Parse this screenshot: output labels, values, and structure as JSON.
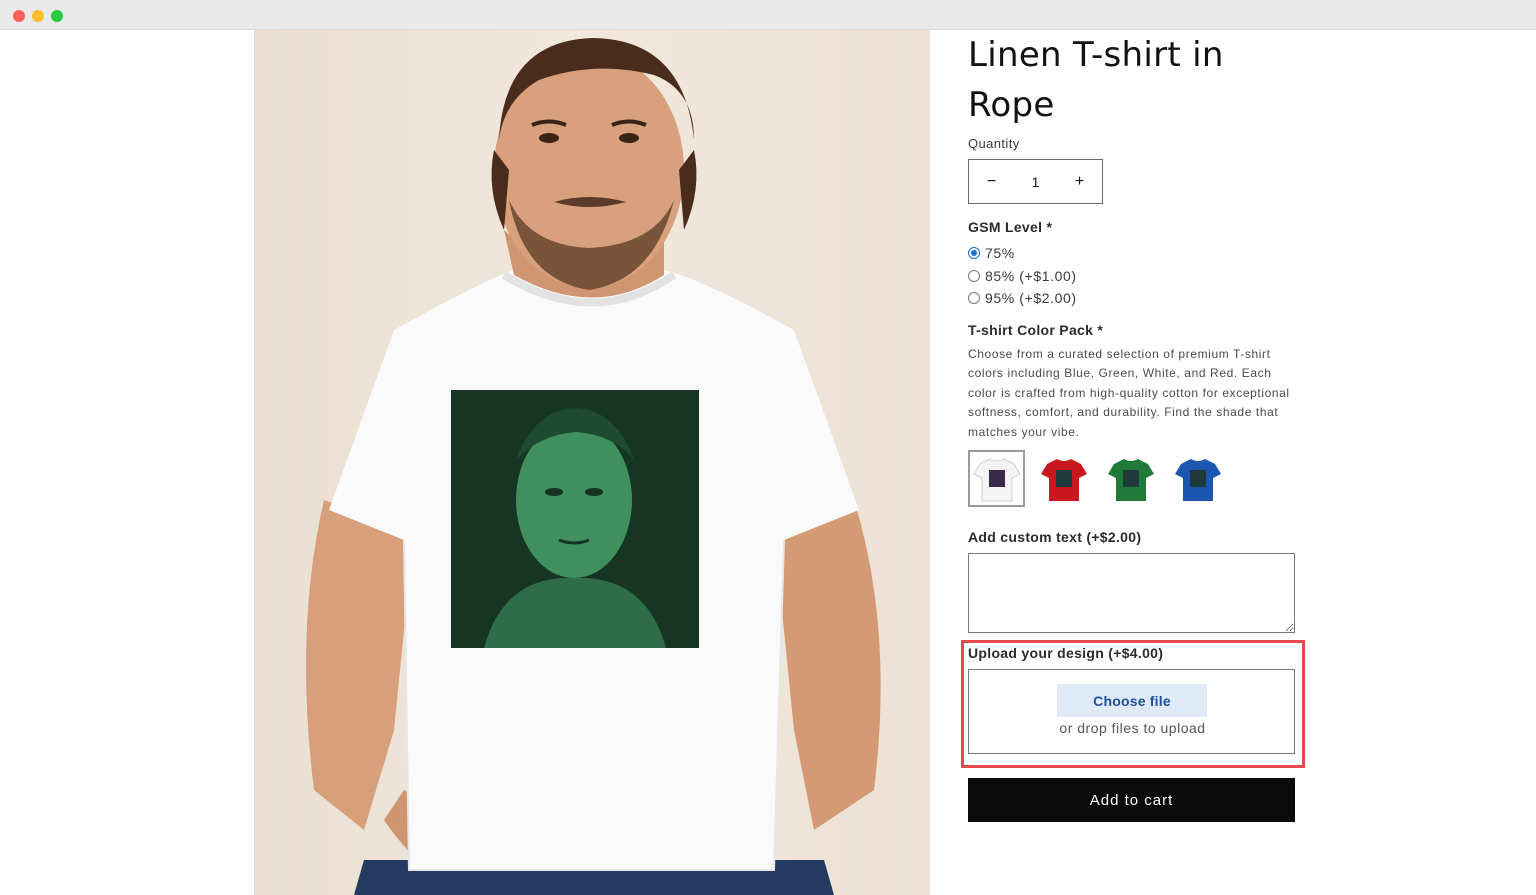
{
  "window": {
    "controls": [
      "close",
      "minimize",
      "maximize"
    ]
  },
  "product": {
    "title": "Linen T-shirt in Rope",
    "image_alt": "Man wearing white T-shirt with green portrait print"
  },
  "quantity": {
    "label": "Quantity",
    "value": "1",
    "decrease": "−",
    "increase": "+"
  },
  "gsm": {
    "label": "GSM Level *",
    "options": [
      {
        "label": "75%",
        "checked": true
      },
      {
        "label": "85% (+$1.00)",
        "checked": false
      },
      {
        "label": "95% (+$2.00)",
        "checked": false
      }
    ]
  },
  "color_pack": {
    "label": "T-shirt Color Pack *",
    "description": "Choose from a curated selection of premium T-shirt colors including Blue, Green, White, and Red. Each color is crafted from high-quality cotton for exceptional softness, comfort, and durability. Find the shade that matches your vibe.",
    "swatches": [
      {
        "name": "White",
        "color": "#f4f4f4",
        "selected": true
      },
      {
        "name": "Red",
        "color": "#c8181e",
        "selected": false
      },
      {
        "name": "Green",
        "color": "#1f7a3a",
        "selected": false
      },
      {
        "name": "Blue",
        "color": "#1c56b0",
        "selected": false
      }
    ]
  },
  "custom_text": {
    "label": "Add custom text (+$2.00)",
    "value": ""
  },
  "upload": {
    "label": "Upload your design (+$4.00)",
    "button": "Choose file",
    "hint": "or drop files to upload"
  },
  "add_to_cart": "Add to cart",
  "colors": {
    "highlight": "#e5484d",
    "accent": "#1f4f9c",
    "cart_bg": "#0b0b0b"
  }
}
